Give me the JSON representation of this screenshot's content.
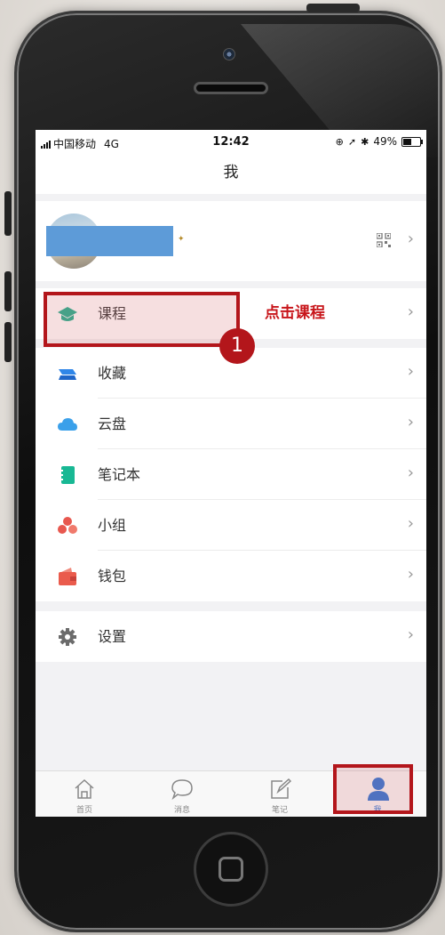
{
  "status_bar": {
    "carrier": "中国移动",
    "network": "4G",
    "time": "12:42",
    "battery": "49%"
  },
  "nav": {
    "title": "我"
  },
  "menu": {
    "course": {
      "label": "课程",
      "icon": "graduation-cap-icon",
      "color": "#1fb08f"
    },
    "items": [
      {
        "label": "收藏",
        "icon": "favorites-icon",
        "color": "#2f86e8"
      },
      {
        "label": "云盘",
        "icon": "cloud-icon",
        "color": "#3aa0ea"
      },
      {
        "label": "笔记本",
        "icon": "notebook-icon",
        "color": "#18b894"
      },
      {
        "label": "小组",
        "icon": "group-icon",
        "color": "#e8584f"
      },
      {
        "label": "钱包",
        "icon": "wallet-icon",
        "color": "#ea5b4c"
      }
    ],
    "settings": {
      "label": "设置",
      "icon": "gear-icon",
      "color": "#6b6b6b"
    }
  },
  "tabbar": {
    "tabs": [
      {
        "label": "首页",
        "icon": "home-icon"
      },
      {
        "label": "消息",
        "icon": "message-icon"
      },
      {
        "label": "笔记",
        "icon": "note-edit-icon"
      },
      {
        "label": "我",
        "icon": "person-icon",
        "active": true
      }
    ],
    "active_color": "#2b74d6"
  },
  "annotation": {
    "hint": "点击课程",
    "step": "1",
    "color": "#b3161b"
  }
}
